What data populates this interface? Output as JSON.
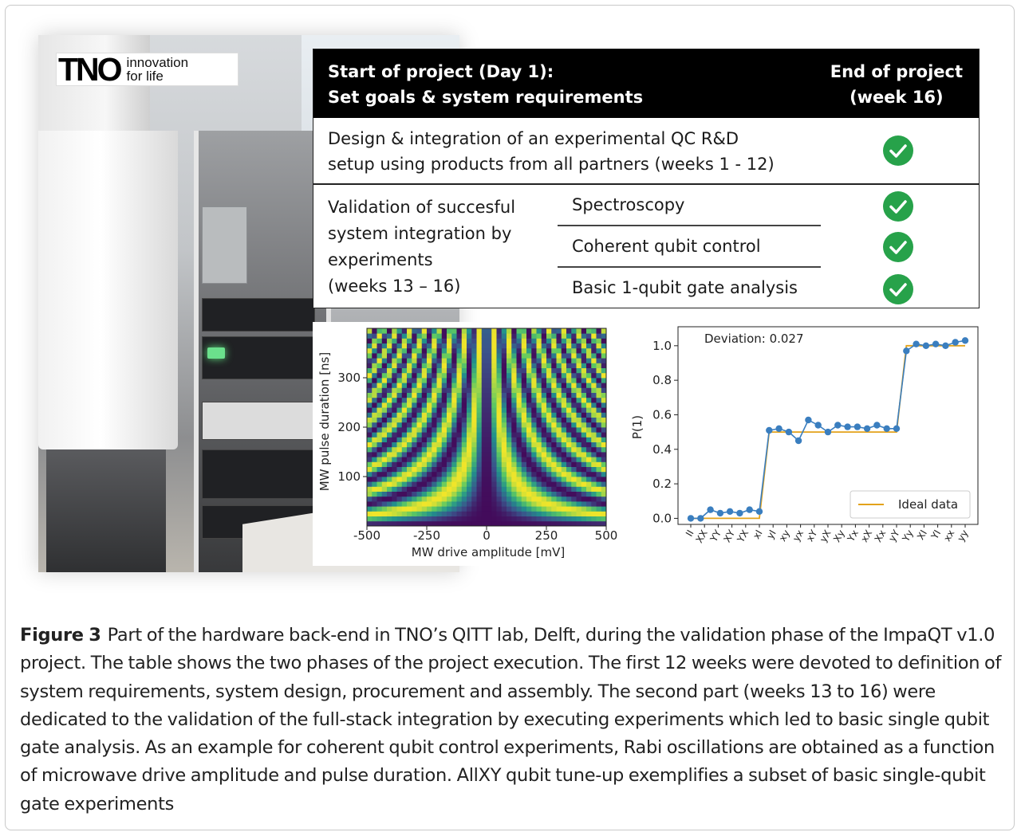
{
  "logo": {
    "brand": "TNO",
    "tagline_line1": "innovation",
    "tagline_line2": "for life"
  },
  "table": {
    "header_left_line1": "Start of project (Day 1):",
    "header_left_line2": "Set goals & system requirements",
    "header_right_line1": "End of project",
    "header_right_line2": "(week 16)",
    "row1_line1": "Design & integration of an experimental QC R&D",
    "row1_line2": "setup using products from all partners (weeks 1 - 12)",
    "row2_line1": "Validation of succesful",
    "row2_line2": "system integration by",
    "row2_line3": "experiments",
    "row2_line4": "(weeks 13 – 16)",
    "experiments": [
      "Spectroscopy",
      "Coherent qubit control",
      "Basic 1-qubit gate analysis"
    ],
    "status_icon": "check-circle-icon",
    "check_color": "#27a24a"
  },
  "chart_data": [
    {
      "type": "heatmap",
      "title": "",
      "xlabel": "MW drive amplitude [mV]",
      "ylabel": "MW pulse duration [ns]",
      "xlim": [
        -500,
        500
      ],
      "ylim": [
        0,
        400
      ],
      "xticks": [
        -500,
        -250,
        0,
        250,
        500
      ],
      "yticks": [
        100,
        200,
        300
      ],
      "colormap": [
        "#440154",
        "#3b528b",
        "#21918c",
        "#5ec962",
        "#fde725"
      ],
      "description_values": "Rabi oscillation pattern: intensity follows sin^2 of (amplitude x duration)"
    },
    {
      "type": "line",
      "title": "",
      "annotation": "Deviation: 0.027",
      "xlabel": "",
      "ylabel": "P(1)",
      "ylim": [
        0.0,
        1.05
      ],
      "yticks": [
        0.0,
        0.2,
        0.4,
        0.6,
        0.8,
        1.0
      ],
      "categories": [
        "II",
        "XX",
        "YY",
        "XY",
        "YX",
        "xI",
        "yI",
        "xy",
        "yx",
        "xY",
        "yX",
        "Xy",
        "Yx",
        "xX",
        "Xx",
        "yY",
        "Yy",
        "XI",
        "YI",
        "xx",
        "yy"
      ],
      "series": [
        {
          "name": "",
          "style": "points",
          "color": "#3a7ebf",
          "values": [
            0.0,
            0.0,
            0.05,
            0.03,
            0.04,
            0.03,
            0.05,
            0.04,
            0.51,
            0.52,
            0.5,
            0.45,
            0.57,
            0.54,
            0.5,
            0.54,
            0.53,
            0.53,
            0.52,
            0.54,
            0.52,
            0.52,
            0.97,
            1.01,
            1.0,
            1.01,
            1.0,
            1.02,
            1.03
          ]
        },
        {
          "name": "Ideal data",
          "style": "line",
          "color": "#e3a21a",
          "values": [
            0,
            0,
            0,
            0,
            0,
            0,
            0,
            0,
            0.5,
            0.5,
            0.5,
            0.5,
            0.5,
            0.5,
            0.5,
            0.5,
            0.5,
            0.5,
            0.5,
            0.5,
            0.5,
            0.5,
            1,
            1,
            1,
            1,
            1,
            1,
            1
          ]
        }
      ],
      "legend": "bottom-right"
    }
  ],
  "caption": {
    "label": "Figure 3",
    "text": "Part of the hardware back-end in TNO’s QITT lab, Delft, during the validation phase of the ImpaQT v1.0 project. The table shows the two phases of the project execution. The first 12 weeks were devoted to definition of system requirements, system design, procurement and assembly. The second part (weeks 13 to 16) were dedicated to the validation of the full-stack integration by executing experiments which led to basic single qubit gate analysis. As an example for coherent qubit control experiments, Rabi oscillations are obtained as a function of microwave drive amplitude and pulse duration. AllXY qubit tune-up exemplifies a subset of basic single-qubit gate experiments"
  }
}
